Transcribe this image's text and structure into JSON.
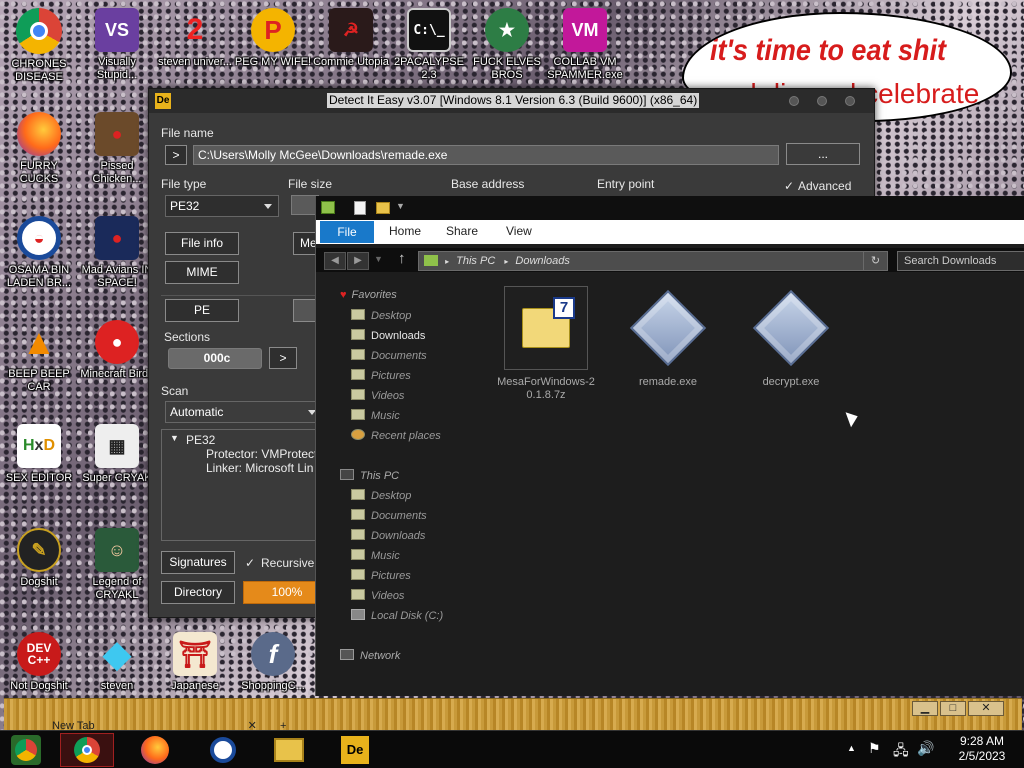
{
  "desktop_icons": [
    {
      "label": "CHRONES DISEASE"
    },
    {
      "label": "Visually Stupid..."
    },
    {
      "label": "steven univer..."
    },
    {
      "label": "PEG MY WIFE!"
    },
    {
      "label": "Commie Utopia"
    },
    {
      "label": "2PACALYPSE 2.3"
    },
    {
      "label": "FUCK ELVES BROS"
    },
    {
      "label": "COLLAB VM SPAMMER.exe"
    },
    {
      "label": "FURRY CUCKS"
    },
    {
      "label": "Pissed Chicken..."
    },
    {
      "label": "OSAMA BIN LADEN BR..."
    },
    {
      "label": "Mad Avians IN SPACE!"
    },
    {
      "label": "BEEP BEEP CAR"
    },
    {
      "label": "Minecraft Birds"
    },
    {
      "label": "SEX EDITOR"
    },
    {
      "label": "Super CRYAK"
    },
    {
      "label": "Dogshit"
    },
    {
      "label": "Legend of CRYAKL"
    },
    {
      "label": "Not Dogshit"
    },
    {
      "label": "steven"
    },
    {
      "label": "Japanese"
    },
    {
      "label": "ShoppingC..."
    }
  ],
  "bubble": {
    "line1": "it's time to eat shit",
    "line2": "and die and celebrate"
  },
  "die": {
    "title": "Detect It Easy v3.07 [Windows 8.1 Version 6.3 (Build 9600)] (x86_64)",
    "icon": "De",
    "file_name_label": "File name",
    "file_path": "C:\\Users\\Molly McGee\\Downloads\\remade.exe",
    "browse_label": "...",
    "go_label": ">",
    "file_type_label": "File type",
    "file_type_value": "PE32",
    "file_size_label": "File size",
    "base_address_label": "Base address",
    "entry_point_label": "Entry point",
    "advanced_label": "Advanced",
    "file_info_label": "File info",
    "memory_label": "Mem",
    "mime_label": "MIME",
    "pe_label": "PE",
    "sections_label": "Sections",
    "sections_value": "000c",
    "sections_go": ">",
    "scan_label": "Scan",
    "scan_value": "Automatic",
    "tree_root": "PE32",
    "tree_items": [
      "Protector: VMProtect",
      "Linker: Microsoft Lin"
    ],
    "signatures_label": "Signatures",
    "recursive_label": "Recursive s",
    "directory_label": "Directory",
    "progress_label": "100%",
    "progress_value": 100
  },
  "explorer": {
    "ribbon_tabs": {
      "file": "File",
      "home": "Home",
      "share": "Share",
      "view": "View"
    },
    "address_parts": [
      "This PC",
      "Downloads"
    ],
    "search_placeholder": "Search Downloads",
    "nav": {
      "favorites": "Favorites",
      "fav_items": [
        "Desktop",
        "Downloads",
        "Documents",
        "Pictures",
        "Videos",
        "Music",
        "Recent places"
      ],
      "this_pc": "This PC",
      "pc_items": [
        "Desktop",
        "Documents",
        "Downloads",
        "Music",
        "Pictures",
        "Videos",
        "Local Disk (C:)"
      ],
      "network": "Network"
    },
    "files": [
      {
        "name": "MesaForWindows-20.1.8.7z"
      },
      {
        "name": "remade.exe"
      },
      {
        "name": "decrypt.exe"
      }
    ]
  },
  "browser_strip": {
    "tab": "New Tab",
    "new_tab": "+"
  },
  "taskbar": {
    "time": "9:28 AM",
    "date": "2/5/2023"
  },
  "colors": {
    "accent_orange": "#e58a1a",
    "ribbon_blue": "#1979ca"
  }
}
